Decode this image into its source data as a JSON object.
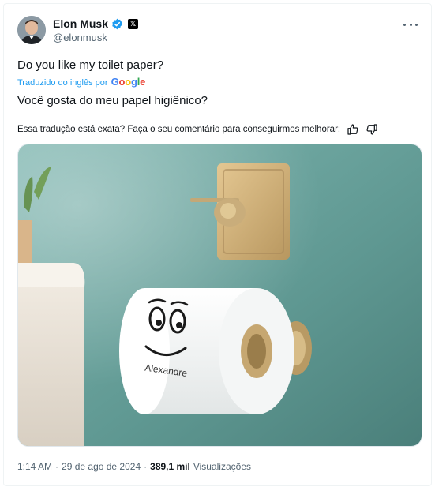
{
  "author": {
    "name": "Elon Musk",
    "handle": "@elonmusk",
    "x_badge": "𝕏"
  },
  "tweet": {
    "text": "Do you like my toilet paper?",
    "translated_by_label": "Traduzido do inglês por",
    "translation_provider": "Google",
    "translated_text": "Você gosta do meu papel higiênico?",
    "feedback_prompt": "Essa tradução está exata? Faça o seu comentário para conseguirmos melhorar:"
  },
  "media": {
    "roll_label": "Alexandre"
  },
  "meta": {
    "time": "1:14 AM",
    "separator": "·",
    "date": "29 de ago de 2024",
    "separator2": "·",
    "views_count": "389,1 mil",
    "views_label": "Visualizações"
  },
  "icons": {
    "verified": "verified-badge-icon",
    "more": "more-options-icon",
    "thumbs_up": "thumbs-up-icon",
    "thumbs_down": "thumbs-down-icon"
  },
  "colors": {
    "link_blue": "#1d9bf0",
    "secondary_text": "#536471",
    "wall_teal": "#6fa8a3"
  }
}
